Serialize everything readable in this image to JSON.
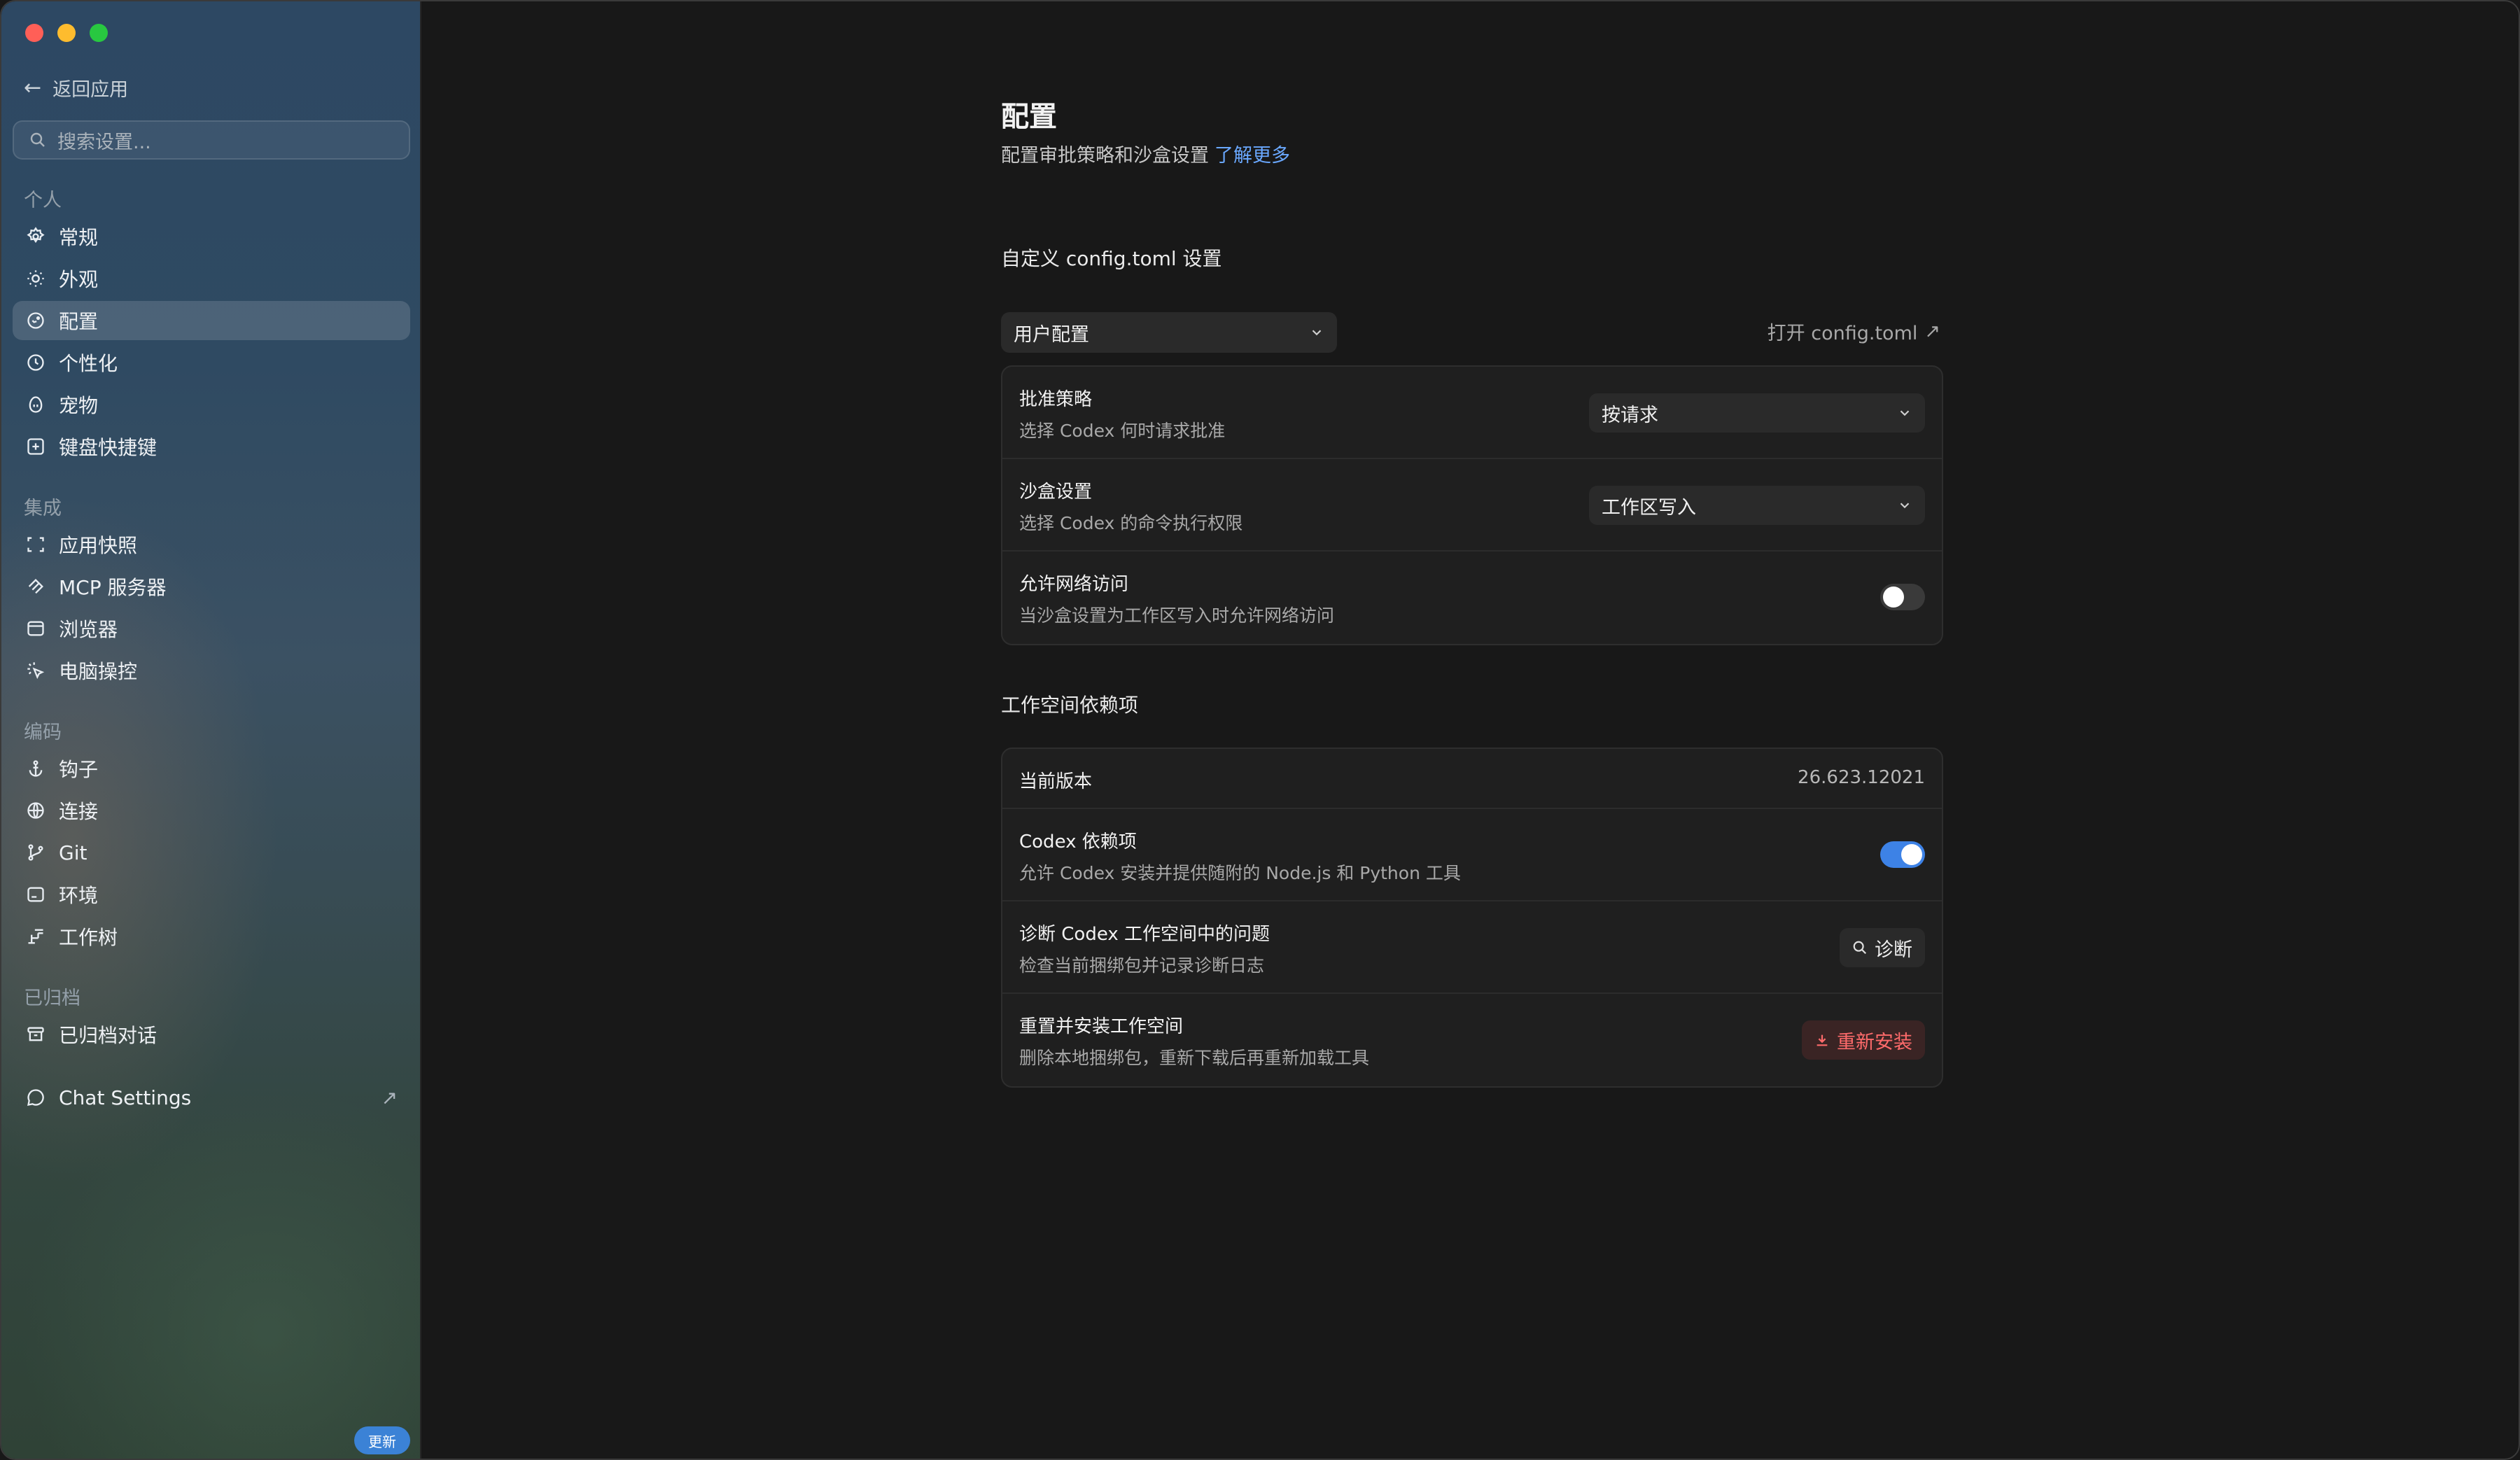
{
  "sidebar": {
    "back_label": "返回应用",
    "search_placeholder": "搜索设置...",
    "sections": [
      {
        "label": "个人",
        "items": [
          {
            "label": "常规",
            "icon": "gear-icon"
          },
          {
            "label": "外观",
            "icon": "sun-icon"
          },
          {
            "label": "配置",
            "icon": "config-icon",
            "active": true
          },
          {
            "label": "个性化",
            "icon": "personalize-icon"
          },
          {
            "label": "宠物",
            "icon": "pet-icon"
          },
          {
            "label": "键盘快捷键",
            "icon": "keyboard-icon"
          }
        ]
      },
      {
        "label": "集成",
        "items": [
          {
            "label": "应用快照",
            "icon": "snapshot-icon"
          },
          {
            "label": "MCP 服务器",
            "icon": "mcp-icon"
          },
          {
            "label": "浏览器",
            "icon": "browser-icon"
          },
          {
            "label": "电脑操控",
            "icon": "computer-control-icon"
          }
        ]
      },
      {
        "label": "编码",
        "items": [
          {
            "label": "钩子",
            "icon": "anchor-icon"
          },
          {
            "label": "连接",
            "icon": "globe-icon"
          },
          {
            "label": "Git",
            "icon": "git-branch-icon"
          },
          {
            "label": "环境",
            "icon": "environment-icon"
          },
          {
            "label": "工作树",
            "icon": "worktree-icon"
          }
        ]
      },
      {
        "label": "已归档",
        "items": [
          {
            "label": "已归档对话",
            "icon": "archive-icon"
          }
        ]
      }
    ],
    "chat_settings_label": "Chat Settings",
    "update_badge": "更新"
  },
  "main": {
    "title": "配置",
    "subtitle": "配置审批策略和沙盒设置",
    "learn_more": "了解更多",
    "config_section_title": "自定义 config.toml 设置",
    "user_config_select": "用户配置",
    "open_config_link": "打开 config.toml",
    "config_rows": {
      "approval": {
        "title": "批准策略",
        "desc": "选择 Codex 何时请求批准",
        "value": "按请求"
      },
      "sandbox": {
        "title": "沙盒设置",
        "desc": "选择 Codex 的命令执行权限",
        "value": "工作区写入"
      },
      "network": {
        "title": "允许网络访问",
        "desc": "当沙盒设置为工作区写入时允许网络访问",
        "enabled": false
      }
    },
    "workspace_section_title": "工作空间依赖项",
    "workspace_rows": {
      "version": {
        "title": "当前版本",
        "value": "26.623.12021"
      },
      "deps": {
        "title": "Codex 依赖项",
        "desc": "允许 Codex 安装并提供随附的 Node.js 和 Python 工具",
        "enabled": true
      },
      "diagnose": {
        "title": "诊断 Codex 工作空间中的问题",
        "desc": "检查当前捆绑包并记录诊断日志",
        "button": "诊断"
      },
      "reinstall": {
        "title": "重置并安装工作空间",
        "desc": "删除本地捆绑包，重新下载后再重新加载工具",
        "button": "重新安装"
      }
    }
  },
  "colors": {
    "accent": "#3d82e6",
    "link": "#6aa8ff",
    "danger": "#ff6b6b",
    "background": "#181818"
  }
}
